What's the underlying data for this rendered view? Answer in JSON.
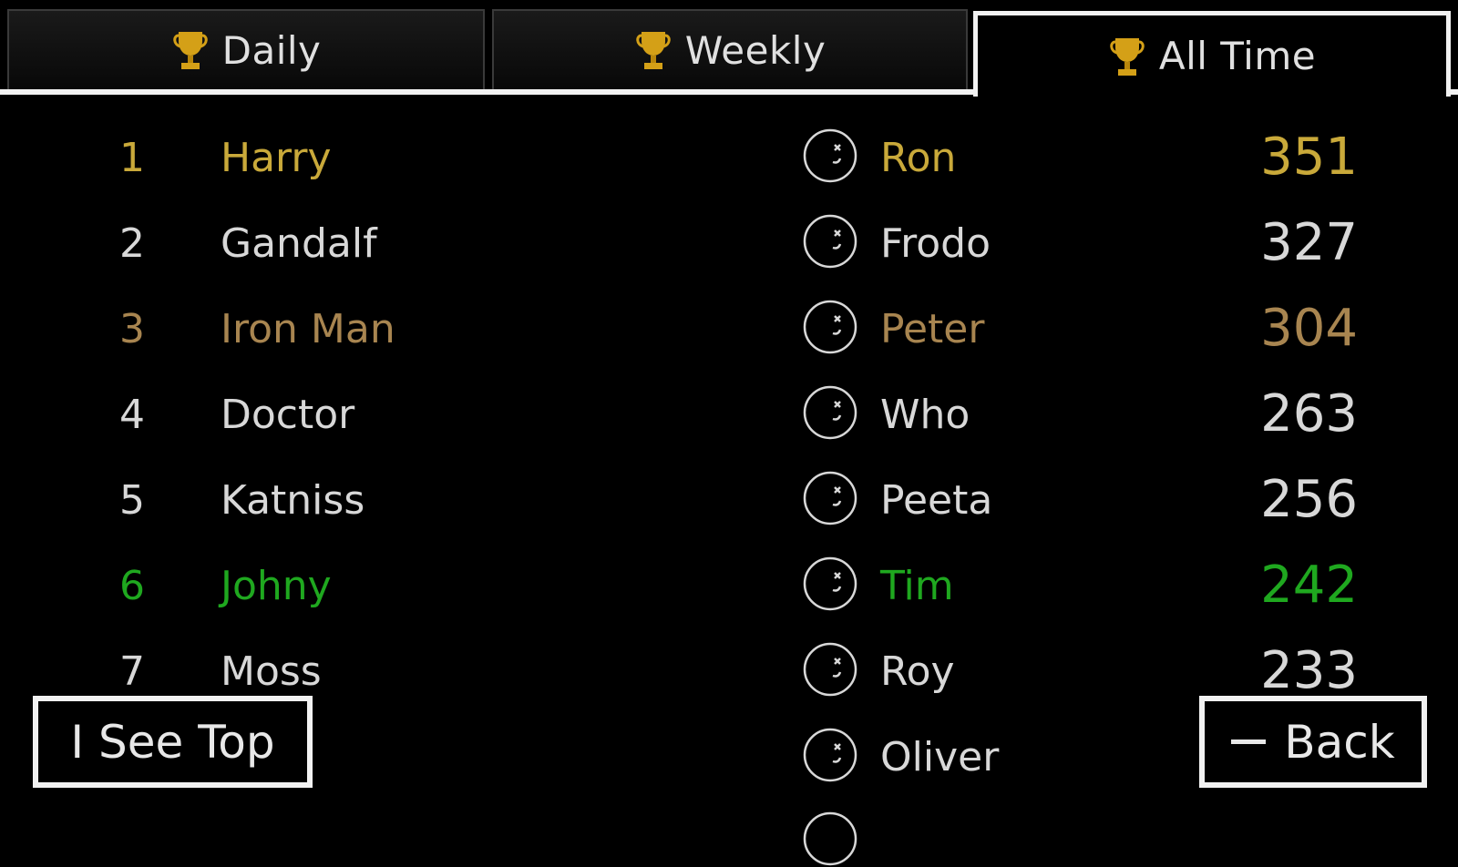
{
  "tabs": [
    {
      "label": "Daily",
      "icon": "trophy-icon",
      "active": false
    },
    {
      "label": "Weekly",
      "icon": "trophy-icon",
      "active": false
    },
    {
      "label": "All Time",
      "icon": "trophy-icon",
      "active": true
    }
  ],
  "rows": [
    {
      "rank": "1",
      "name": "Harry",
      "opponent": "Ron",
      "score": "351",
      "color": "#c9a93a"
    },
    {
      "rank": "2",
      "name": "Gandalf",
      "opponent": "Frodo",
      "score": "327",
      "color": "#d8d8d8"
    },
    {
      "rank": "3",
      "name": "Iron Man",
      "opponent": "Peter",
      "score": "304",
      "color": "#a88550"
    },
    {
      "rank": "4",
      "name": "Doctor",
      "opponent": "Who",
      "score": "263",
      "color": "#d8d8d8"
    },
    {
      "rank": "5",
      "name": "Katniss",
      "opponent": "Peeta",
      "score": "256",
      "color": "#d8d8d8"
    },
    {
      "rank": "6",
      "name": "Johny",
      "opponent": "Tim",
      "score": "242",
      "color": "#1fa81f"
    },
    {
      "rank": "7",
      "name": "Moss",
      "opponent": "Roy",
      "score": "233",
      "color": "#d8d8d8"
    },
    {
      "rank": "",
      "name": "",
      "opponent": "Oliver",
      "score": "",
      "color": "#d8d8d8"
    }
  ],
  "buttons": {
    "see_top_label": "I See Top",
    "back_label": "Back"
  },
  "colors": {
    "gold": "#c9a93a",
    "bronze": "#a88550",
    "highlight_green": "#1fa81f",
    "text_default": "#d8d8d8",
    "border_white": "#f2f2f2"
  }
}
